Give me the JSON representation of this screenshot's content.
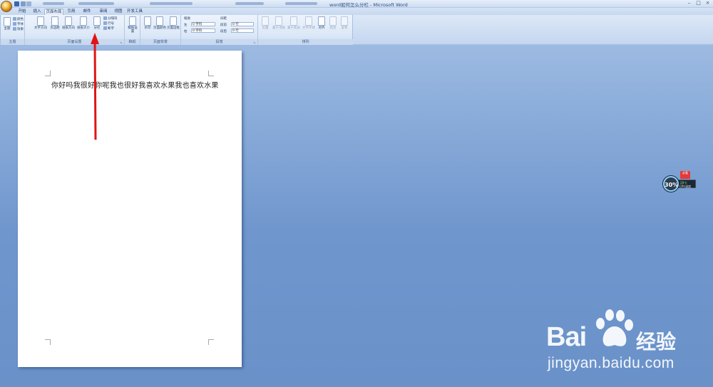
{
  "window": {
    "title": "word如何怎么分栏 - Microsoft Word",
    "minimize": "–",
    "maximize": "□",
    "close": "×"
  },
  "tabs": [
    {
      "label": "开始"
    },
    {
      "label": "插入"
    },
    {
      "label": "页面布局",
      "active": true
    },
    {
      "label": "引用"
    },
    {
      "label": "邮件"
    },
    {
      "label": "审阅"
    },
    {
      "label": "视图"
    },
    {
      "label": "开发工具"
    }
  ],
  "ribbon": {
    "themes": {
      "label": "主题",
      "main": "主题",
      "colors": "颜色",
      "fonts": "字体",
      "effects": "效果"
    },
    "page_setup": {
      "label": "页面设置",
      "text_direction": "文字方向",
      "margins": "页边距",
      "orientation": "纸张方向",
      "size": "纸张大小",
      "columns": "分栏",
      "breaks": "分隔符",
      "line_numbers": "行号",
      "hyphenation": "断字"
    },
    "draft": {
      "label": "稿纸",
      "draft_settings": "稿纸设置"
    },
    "page_background": {
      "label": "页面背景",
      "watermark": "水印",
      "page_color": "页面颜色",
      "page_borders": "页面边框"
    },
    "paragraph": {
      "label": "段落",
      "indent": "缩进",
      "left_label": "左",
      "left_value": "0 字符",
      "right_label": "右",
      "right_value": "0 字符",
      "spacing": "间距",
      "before_label": "段前",
      "before_value": "0 行",
      "after_label": "段后",
      "after_value": "0 行"
    },
    "arrange": {
      "label": "排列",
      "position": "位置",
      "bring_front": "置于顶层",
      "send_back": "置于底层",
      "text_wrap": "文字环绕",
      "align": "对齐",
      "group": "组合",
      "rotate": "旋转"
    }
  },
  "document": {
    "body_text": "你好吗我很好你呢我也很好我喜欢水果我也喜欢水果"
  },
  "widget": {
    "cpu_percent": "30%",
    "temperature": "28℃",
    "cpu_label": "CPU温度",
    "badge": "必看"
  },
  "watermark": {
    "logo": "Bai 经验",
    "logo_latin": "Bai",
    "logo_cn": "经验",
    "url": "jingyan.baidu.com"
  },
  "colors": {
    "ribbon_bg": "#dce8f7",
    "arrow": "#e01414",
    "desktop": "#7a9fd3"
  }
}
